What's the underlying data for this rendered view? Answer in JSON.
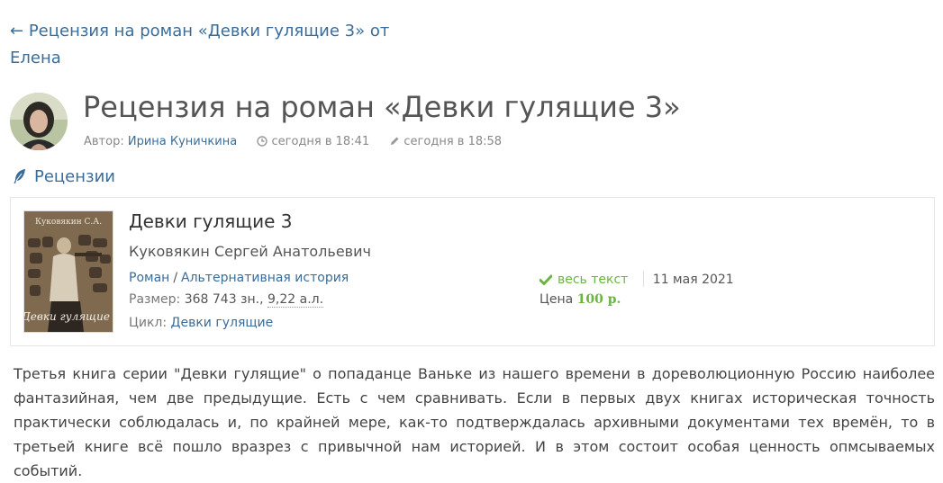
{
  "nav": {
    "back_arrow": "←",
    "back_label": "Рецензия на роман «Девки гулящие 3» от Елена"
  },
  "header": {
    "title": "Рецензия на роман «Девки гулящие 3»",
    "author_prefix": "Автор:",
    "author_name": "Ирина Куничкина",
    "created": "сегодня в 18:41",
    "edited": "сегодня в 18:58"
  },
  "category": {
    "label": "Рецензии",
    "icon": "feather-icon"
  },
  "book": {
    "cover_text_top": "Куковякин С.А.",
    "cover_text_bottom": "Девки гулящие",
    "title": "Девки гулящие 3",
    "author": "Куковякин Сергей Анатольевич",
    "type": "Роман",
    "genre": "Альтернативная история",
    "size_label": "Размер:",
    "size_chars": "368 743 зн.,",
    "size_al": "9,22 а.л.",
    "cycle_label": "Цикл:",
    "cycle": "Девки гулящие",
    "status": "весь текст",
    "date": "11 мая 2021",
    "price_label": "Цена",
    "price": "100 р."
  },
  "review": {
    "text": "Третья книга серии \"Девки гулящие\" о попаданце Ваньке из нашего времени в дореволюционную Россию наиболее фантазийная, чем две предыдущие. Есть с чем сравнивать. Если в первых двух книгах историческая точность практически соблюдалась и, по крайней мере, как-то подтверждалась архивными документами тех времён, то в третьей книге всё пошло вразрез с привычной нам историей. И в этом состоит особая ценность опмсываемых событий."
  },
  "colors": {
    "link": "#3a6d99",
    "accent_green": "#6bb53f"
  }
}
